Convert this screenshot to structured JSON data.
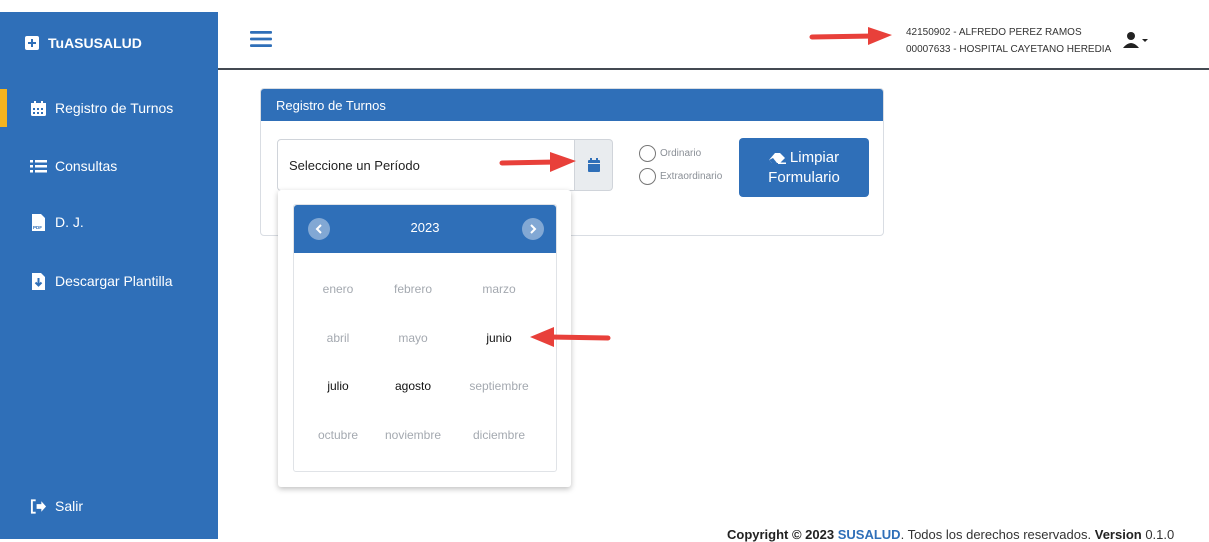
{
  "sidebar": {
    "brand": "TuASUSALUD",
    "items": [
      {
        "label": "Registro de Turnos",
        "icon": "calendar-icon"
      },
      {
        "label": "Consultas",
        "icon": "list-icon"
      },
      {
        "label": "D. J.",
        "icon": "pdf-file-icon"
      },
      {
        "label": "Descargar Plantilla",
        "icon": "download-file-icon"
      }
    ],
    "logout": "Salir"
  },
  "header": {
    "user_line1": "42150902 - ALFREDO PEREZ RAMOS",
    "user_line2": "00007633 - HOSPITAL CAYETANO HEREDIA"
  },
  "panel": {
    "title": "Registro de Turnos",
    "period_label": "Seleccione un Período",
    "radio_ordinario": "Ordinario",
    "radio_extraordinario": "Extraordinario",
    "clear_line1": "Limpiar",
    "clear_line2": "Formulario"
  },
  "picker": {
    "year": "2023",
    "months": [
      {
        "label": "enero",
        "enabled": false
      },
      {
        "label": "febrero",
        "enabled": false
      },
      {
        "label": "marzo",
        "enabled": false
      },
      {
        "label": "abril",
        "enabled": false
      },
      {
        "label": "mayo",
        "enabled": false
      },
      {
        "label": "junio",
        "enabled": true
      },
      {
        "label": "julio",
        "enabled": true
      },
      {
        "label": "agosto",
        "enabled": true
      },
      {
        "label": "septiembre",
        "enabled": false
      },
      {
        "label": "octubre",
        "enabled": false
      },
      {
        "label": "noviembre",
        "enabled": false
      },
      {
        "label": "diciembre",
        "enabled": false
      }
    ]
  },
  "footer": {
    "copyright": "Copyright © 2023",
    "brand": "SUSALUD",
    "rights": ". Todos los derechos reservados.",
    "version_label": "Version",
    "version": "0.1.0"
  },
  "colors": {
    "primary": "#2f6fb8",
    "active_marker": "#f5b41e",
    "annotation_arrow": "#e8403a"
  }
}
